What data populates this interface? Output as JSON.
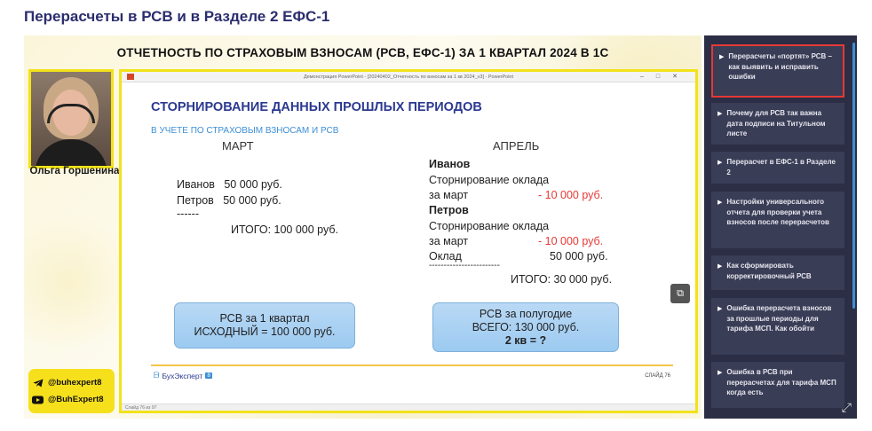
{
  "page": {
    "title": "Перерасчеты в РСВ и в Разделе 2 ЕФС-1"
  },
  "video": {
    "heading": "ОТЧЕТНОСТЬ ПО СТРАХОВЫМ ВЗНОСАМ (РСВ, ЕФС-1) ЗА 1 КВАРТАЛ 2024 В 1С",
    "presenter_name": "Ольга Горшенина",
    "social": [
      {
        "icon": "telegram-icon",
        "handle": "@buhexpert8"
      },
      {
        "icon": "youtube-icon",
        "handle": "@BuhExpert8"
      }
    ]
  },
  "window": {
    "title": "Демонстрация PowerPoint - [20240402_Отчетность по взносам за 1 кв 2024_v3] - PowerPoint",
    "status": "Слайд 76 из 97"
  },
  "slide": {
    "title": "СТОРНИРОВАНИЕ ДАННЫХ ПРОШЛЫХ ПЕРИОДОВ",
    "subtitle": "В УЧЕТЕ ПО СТРАХОВЫМ ВЗНОСАМ И РСВ",
    "march": {
      "header": "МАРТ",
      "row1": "Иванов   50 000 руб.",
      "row2": "Петров   50 000 руб.",
      "divider": "------",
      "total": "ИТОГО: 100 000 руб."
    },
    "april": {
      "header": "АПРЕЛЬ",
      "ivanov": "Иванов",
      "storno1": "Сторнирование оклада",
      "for_march1": "за март",
      "amount1": "- 10 000 руб.",
      "petrov": "Петров",
      "storno2": "Сторнирование оклада",
      "for_march2": "за март",
      "amount2": "- 10 000 руб.",
      "salary": "Оклад",
      "salary_amount": "50 000 руб.",
      "divider": "------------------------",
      "total": "ИТОГО: 30 000 руб."
    },
    "box1": {
      "line1": "РСВ за 1 квартал",
      "line2": "ИСХОДНЫЙ = 100 000 руб."
    },
    "box2": {
      "line1": "РСВ за полугодие",
      "line2": "ВСЕГО: 130 000 руб.",
      "line3": "2 кв = ?"
    },
    "brand": "БухЭксперт",
    "brand_badge": "8",
    "slide_number": "СЛАЙД 76"
  },
  "playlist": [
    {
      "title": "Перерасчеты «портят» РСВ – как выявить и исправить ошибки",
      "active": true
    },
    {
      "title": "Почему для РСВ так важна дата подписи на Титульном листе",
      "active": false
    },
    {
      "title": "Перерасчет в ЕФС-1 в Разделе 2",
      "active": false
    },
    {
      "title": "Настройки универсального отчета для проверки учета взносов после перерасчетов",
      "active": false
    },
    {
      "title": "Как сформировать корректировочный РСВ",
      "active": false
    },
    {
      "title": "Ошибка перерасчета взносов за прошлые периоды для тарифа МСП. Как обойти",
      "active": false
    },
    {
      "title": "Ошибка в РСВ при перерасчетах для тарифа МСП когда есть",
      "active": false
    }
  ],
  "colors": {
    "accent": "#2b2d6e",
    "highlight": "#f2e21a",
    "negative": "#e53935",
    "playlist_bg": "#2b2e45"
  }
}
